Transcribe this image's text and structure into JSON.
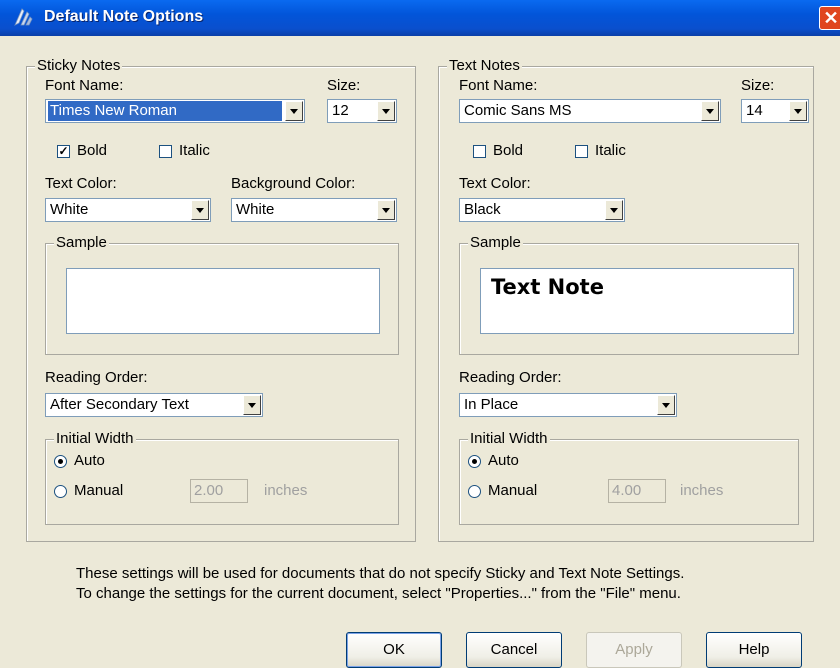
{
  "window": {
    "title": "Default Note Options"
  },
  "sticky": {
    "group_label": "Sticky Notes",
    "font_name_label": "Font Name:",
    "font_name_value": "Times New Roman",
    "size_label": "Size:",
    "size_value": "12",
    "bold_label": "Bold",
    "bold_checked": true,
    "italic_label": "Italic",
    "italic_checked": false,
    "text_color_label": "Text Color:",
    "text_color_value": "White",
    "bg_color_label": "Background Color:",
    "bg_color_value": "White",
    "sample_label": "Sample",
    "sample_text": "",
    "reading_order_label": "Reading Order:",
    "reading_order_value": "After Secondary Text",
    "initial_width_label": "Initial Width",
    "auto_label": "Auto",
    "manual_label": "Manual",
    "selected_width_mode": "Auto",
    "manual_value": "2.00",
    "units_label": "inches"
  },
  "text": {
    "group_label": "Text Notes",
    "font_name_label": "Font Name:",
    "font_name_value": "Comic Sans MS",
    "size_label": "Size:",
    "size_value": "14",
    "bold_label": "Bold",
    "bold_checked": false,
    "italic_label": "Italic",
    "italic_checked": false,
    "text_color_label": "Text Color:",
    "text_color_value": "Black",
    "sample_label": "Sample",
    "sample_text": "Text Note",
    "reading_order_label": "Reading Order:",
    "reading_order_value": "In Place",
    "initial_width_label": "Initial Width",
    "auto_label": "Auto",
    "manual_label": "Manual",
    "selected_width_mode": "Auto",
    "manual_value": "4.00",
    "units_label": "inches"
  },
  "info": {
    "line1": "These settings will be used for documents that do not specify Sticky and Text Note Settings.",
    "line2": "To change the settings for the current document, select \"Properties...\" from the \"File\" menu."
  },
  "buttons": {
    "ok": "OK",
    "cancel": "Cancel",
    "apply": "Apply",
    "help": "Help"
  },
  "colors": {
    "titlebar": "#0255d9",
    "face": "#ece9d8",
    "selection": "#316ac5",
    "close": "#e0461f"
  }
}
